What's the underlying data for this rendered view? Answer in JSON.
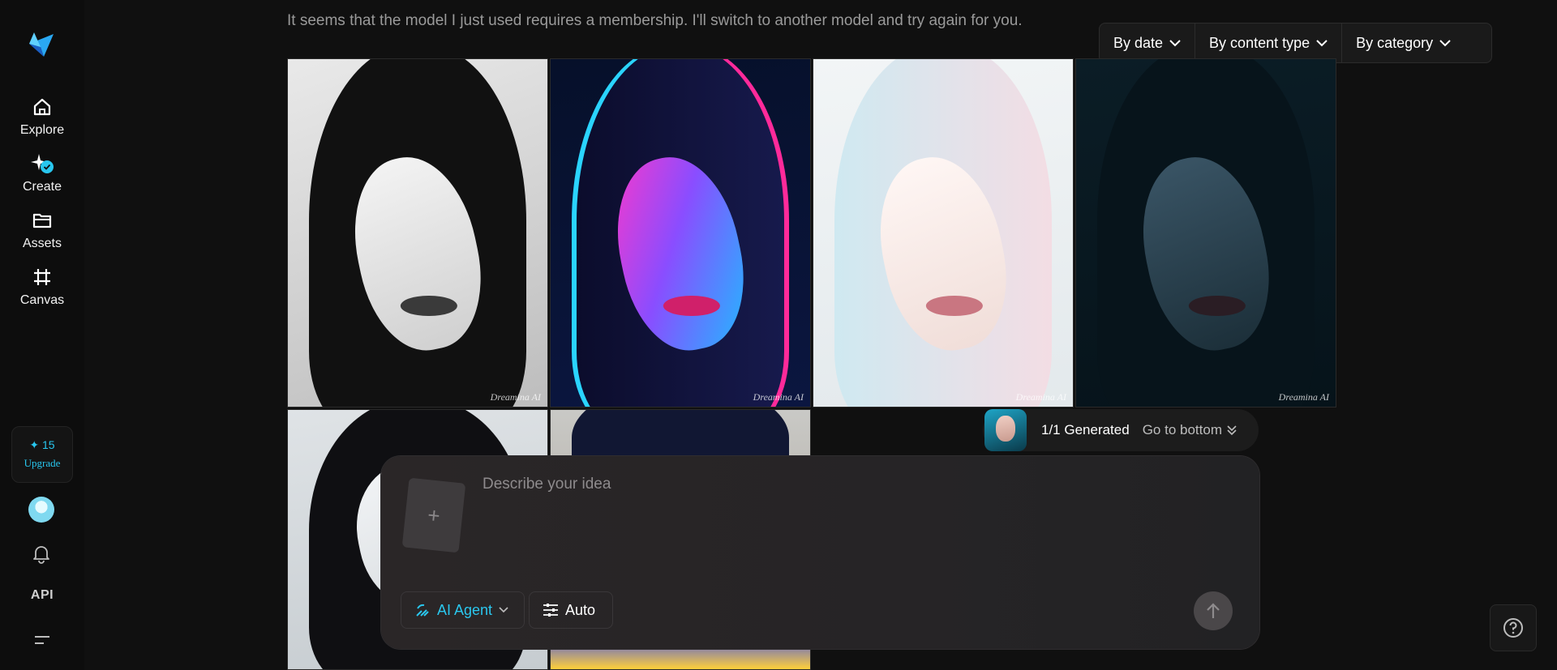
{
  "sidebar": {
    "logo_icon": "dreamina-logo-icon",
    "nav": [
      {
        "label": "Explore",
        "icon": "home-icon"
      },
      {
        "label": "Create",
        "icon": "create-sparkle-icon"
      },
      {
        "label": "Assets",
        "icon": "folder-icon"
      },
      {
        "label": "Canvas",
        "icon": "crop-frame-icon"
      }
    ],
    "credits": "15",
    "upgrade_label": "Upgrade",
    "api_label": "API",
    "bell_icon": "bell-icon",
    "menu_icon": "menu-collapse-icon"
  },
  "message": {
    "text": "It seems that the model I just used requires a membership. I'll switch to another model and try again for you."
  },
  "filters": [
    {
      "label": "By date"
    },
    {
      "label": "By content type"
    },
    {
      "label": "By category"
    }
  ],
  "gallery": {
    "watermark": "Dreamina AI",
    "images": [
      {
        "style": "black-and-white portrait"
      },
      {
        "style": "neon pink-blue portrait"
      },
      {
        "style": "pastel white-hair portrait"
      },
      {
        "style": "dark teal portrait"
      },
      {
        "style": "cool-toned portrait with red lips"
      },
      {
        "style": "colorful portrait"
      }
    ]
  },
  "generation": {
    "status": "1/1 Generated",
    "go_bottom_label": "Go to bottom"
  },
  "prompt": {
    "placeholder": "Describe your idea",
    "agent_label": "AI Agent",
    "auto_label": "Auto"
  },
  "colors": {
    "accent": "#28c6ee",
    "background": "#101010"
  }
}
